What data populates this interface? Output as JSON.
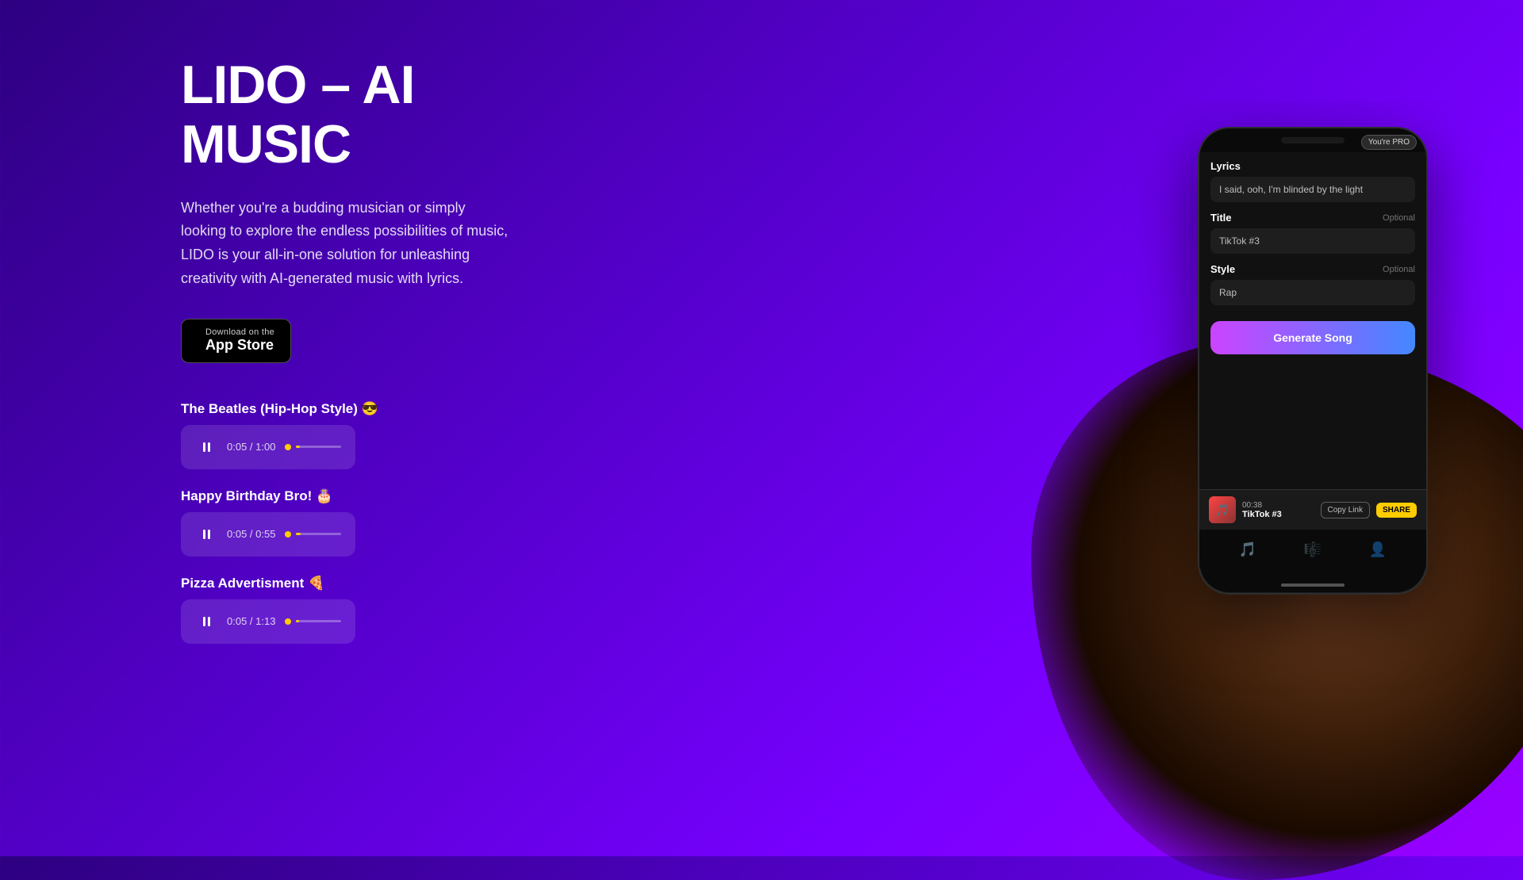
{
  "hero": {
    "title_line1": "LIDO – AI",
    "title_line2": "MUSIC",
    "description": "Whether you're a budding musician or simply looking to explore the endless possibilities of music, LIDO is your all-in-one solution for unleashing creativity with AI-generated music with lyrics.",
    "app_store": {
      "small_text": "Download on the",
      "big_text": "App Store"
    }
  },
  "tracks": [
    {
      "title": "The Beatles (Hip-Hop Style) 😎",
      "current_time": "0:05",
      "total_time": "1:00",
      "progress_pct": 8
    },
    {
      "title": "Happy Birthday Bro! 🎂",
      "current_time": "0:05",
      "total_time": "0:55",
      "progress_pct": 9
    },
    {
      "title": "Pizza Advertisment 🍕",
      "current_time": "0:05",
      "total_time": "1:13",
      "progress_pct": 7
    }
  ],
  "phone": {
    "pro_badge": "You're PRO",
    "lyrics_label": "Lyrics",
    "lyrics_value": "I said, ooh, I'm blinded by the light",
    "title_label": "Title",
    "title_optional": "Optional",
    "title_value": "TikTok #3",
    "style_label": "Style",
    "style_optional": "Optional",
    "style_value": "Rap",
    "generate_btn": "Generate Song",
    "player": {
      "time": "00:38",
      "name": "TikTok #3",
      "copy_btn": "Copy Link",
      "share_btn": "SHARE"
    }
  }
}
